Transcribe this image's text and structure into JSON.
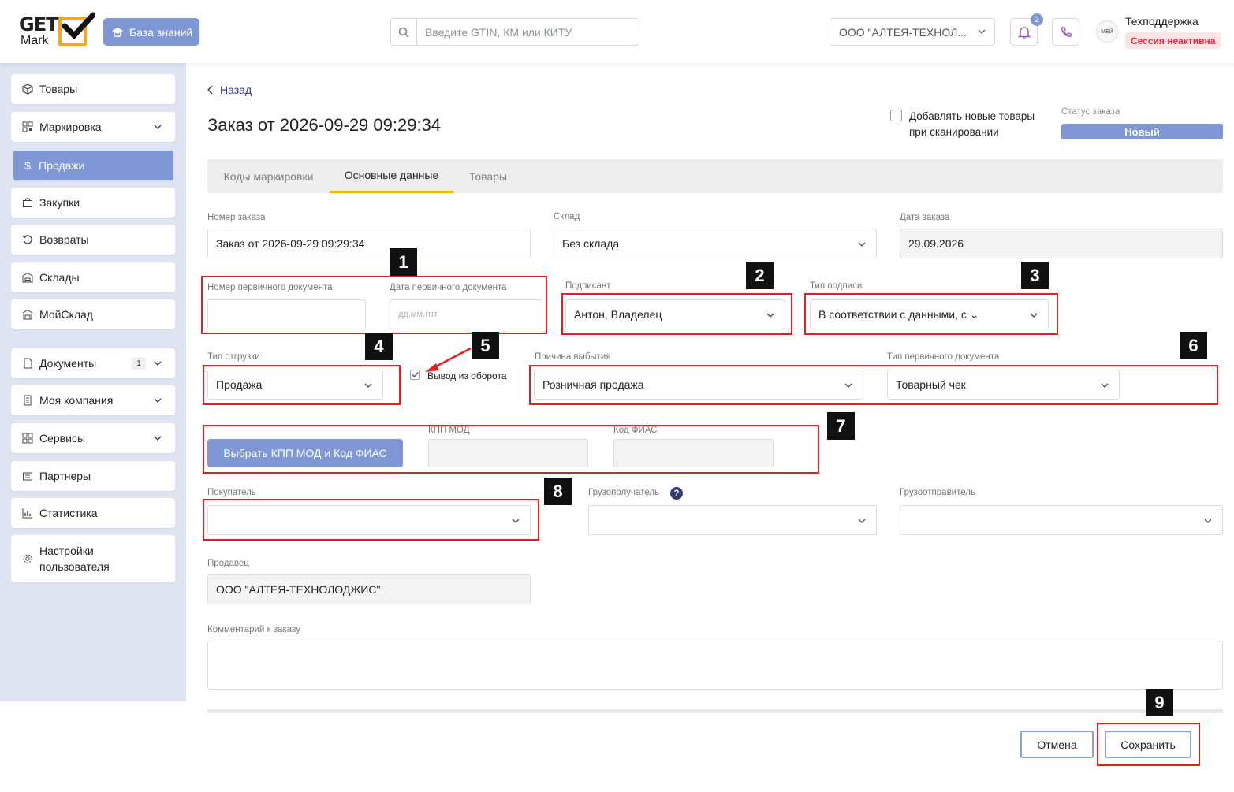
{
  "header": {
    "logo_top": "GET",
    "logo_bottom": "Mark",
    "kb_button": "База знаний",
    "search_placeholder": "Введите GTIN, КМ или КИТУ",
    "org_selected": "ООО \"АЛТЕЯ-ТЕХНОЛ...",
    "notif_count": "2",
    "avatar_text": "МЕЙ",
    "user_name": "Техподдержка",
    "session_status": "Сессия неактивна"
  },
  "sidebar": {
    "items": [
      {
        "label": "Товары",
        "icon": "box-icon"
      },
      {
        "label": "Маркировка",
        "icon": "qr-icon"
      },
      {
        "label": "Продажи",
        "icon": "dollar-icon"
      },
      {
        "label": "Закупки",
        "icon": "bag-icon"
      },
      {
        "label": "Возвраты",
        "icon": "return-icon"
      },
      {
        "label": "Склады",
        "icon": "warehouse-icon"
      },
      {
        "label": "МойСклад",
        "icon": "moysklad-icon"
      },
      {
        "label": "Документы",
        "icon": "document-icon",
        "count": "1"
      },
      {
        "label": "Моя компания",
        "icon": "building-icon"
      },
      {
        "label": "Сервисы",
        "icon": "grid-icon"
      },
      {
        "label": "Партнеры",
        "icon": "partners-icon"
      },
      {
        "label": "Статистика",
        "icon": "chart-icon"
      },
      {
        "label": "Настройки пользователя",
        "label_line1": "Настройки",
        "label_line2": "пользователя",
        "icon": "gear-icon"
      }
    ]
  },
  "page": {
    "back": "Назад",
    "title": "Заказ от 2026-09-29 09:29:34",
    "add_on_scan_line1": "Добавлять новые товары",
    "add_on_scan_line2": "при сканировании",
    "status_label": "Статус заказа",
    "status_value": "Новый"
  },
  "tabs": [
    {
      "label": "Коды маркировки",
      "active": false
    },
    {
      "label": "Основные данные",
      "active": true
    },
    {
      "label": "Товары",
      "active": false
    }
  ],
  "form": {
    "order_number_label": "Номер заказа",
    "order_number_value": "Заказ от 2026-09-29 09:29:34",
    "warehouse_label": "Склад",
    "warehouse_value": "Без склада",
    "order_date_label": "Дата заказа",
    "order_date_value": "29.09.2026",
    "primary_doc_number_label": "Номер первичного документа",
    "primary_doc_number_value": "",
    "primary_doc_date_label": "Дата первичного документа",
    "primary_doc_date_placeholder": "дд.мм.гггг",
    "signer_label": "Подписант",
    "signer_value": "Антон, Владелец",
    "signature_type_label": "Тип подписи",
    "signature_type_value": "В соответствии с данными, с ⌄",
    "shipment_type_label": "Тип отгрузки",
    "shipment_type_value": "Продажа",
    "withdrawal_label": "Вывод из оборота",
    "withdrawal_checked": true,
    "disposal_reason_label": "Причина выбытия",
    "disposal_reason_value": "Розничная продажа",
    "primary_doc_type_label": "Тип первичного документа",
    "primary_doc_type_value": "Товарный чек",
    "kpp_button": "Выбрать КПП МОД и Код ФИАС",
    "kpp_mod_label": "КПП МОД",
    "kpp_mod_value": "",
    "fias_label": "Код ФИАС",
    "fias_value": "",
    "buyer_label": "Покупатель",
    "buyer_value": "",
    "consignee_label": "Грузополучатель",
    "consignee_value": "",
    "shipper_label": "Грузоотправитель",
    "shipper_value": "",
    "seller_label": "Продавец",
    "seller_value": "ООО \"АЛТЕЯ-ТЕХНОЛОДЖИС\"",
    "comment_label": "Комментарий к заказу",
    "comment_value": ""
  },
  "actions": {
    "cancel": "Отмена",
    "save": "Сохранить"
  },
  "annotations": [
    "1",
    "2",
    "3",
    "4",
    "5",
    "6",
    "7",
    "8",
    "9"
  ],
  "colors": {
    "accent": "#7f97d4",
    "highlight": "#e31e24",
    "tab_underline": "#f2b705",
    "logo_orange": "#f5a623"
  }
}
